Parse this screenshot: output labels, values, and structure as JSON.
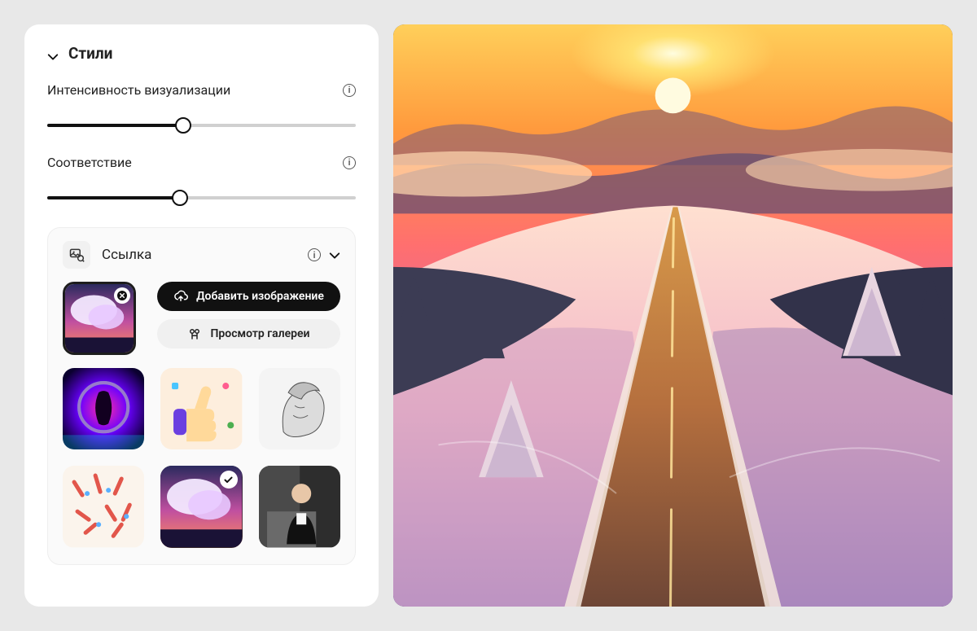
{
  "section": {
    "title": "Стили"
  },
  "sliders": {
    "intensity": {
      "label": "Интенсивность визуализации",
      "value": 44
    },
    "match": {
      "label": "Соответствие",
      "value": 43
    }
  },
  "reference": {
    "title": "Ссылка",
    "add_image_label": "Добавить изображение",
    "browse_gallery_label": "Просмотр галереи",
    "selected_index": 4,
    "uploaded_thumb_name": "clouds-reference",
    "styles": [
      {
        "id": "neon-portal"
      },
      {
        "id": "3d-thumbs-up"
      },
      {
        "id": "marble-sketch"
      },
      {
        "id": "confetti-hands"
      },
      {
        "id": "pink-clouds"
      },
      {
        "id": "studio-portrait"
      }
    ]
  }
}
